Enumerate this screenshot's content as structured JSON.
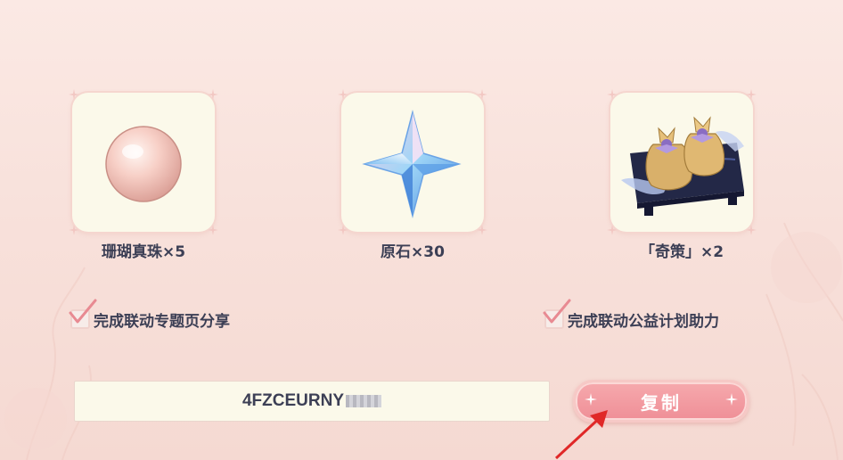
{
  "rewards": [
    {
      "label": "珊瑚真珠×5",
      "icon": "coral-pearl-icon"
    },
    {
      "label": "原石×30",
      "icon": "primogem-icon"
    },
    {
      "label": "「奇策」×2",
      "icon": "gift-bags-icon"
    }
  ],
  "tasks": [
    {
      "label": "完成联动专题页分享",
      "checked": true
    },
    {
      "label": "完成联动公益计划助力",
      "checked": true
    }
  ],
  "code": {
    "value": "4FZCEURNY"
  },
  "copy_button": {
    "label": "复制"
  },
  "colors": {
    "accent": "#ef8f97",
    "text": "#3c3f55",
    "card": "#fbf9ea",
    "check": "#e88a92",
    "arrow": "#e02828"
  }
}
